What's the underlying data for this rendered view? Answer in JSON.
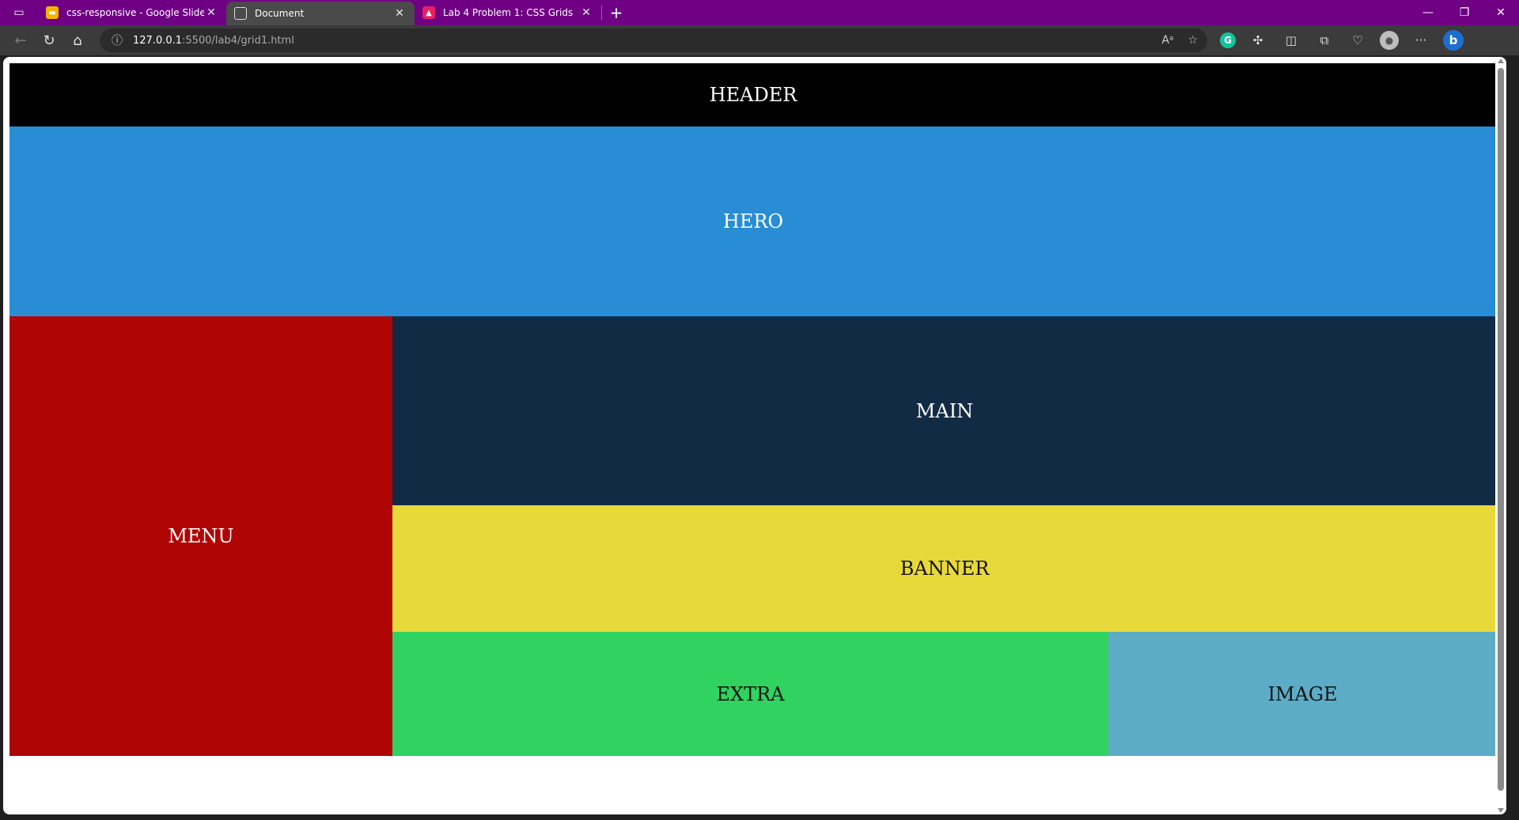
{
  "browser": {
    "tabs": [
      {
        "title": "css-responsive - Google Slides",
        "favicon": "slides-icon",
        "color": "#f4b400"
      },
      {
        "title": "Document",
        "favicon": "document-icon",
        "active": true
      },
      {
        "title": "Lab 4 Problem 1: CSS Grids",
        "favicon": "image-icon",
        "color": "#e91e63"
      }
    ],
    "address": {
      "host": "127.0.0.1",
      "rest": ":5500/lab4/grid1.html"
    }
  },
  "page": {
    "header": "HEADER",
    "hero": "HERO",
    "menu": "MENU",
    "main": "MAIN",
    "banner": "BANNER",
    "extra": "EXTRA",
    "image": "IMAGE"
  },
  "colors": {
    "header": "#000000",
    "hero": "#298dd5",
    "menu": "#b00505",
    "main": "#112b45",
    "banner": "#e8d93b",
    "extra": "#30d35f",
    "image": "#5dacc6",
    "titlebar": "#6f0084"
  }
}
